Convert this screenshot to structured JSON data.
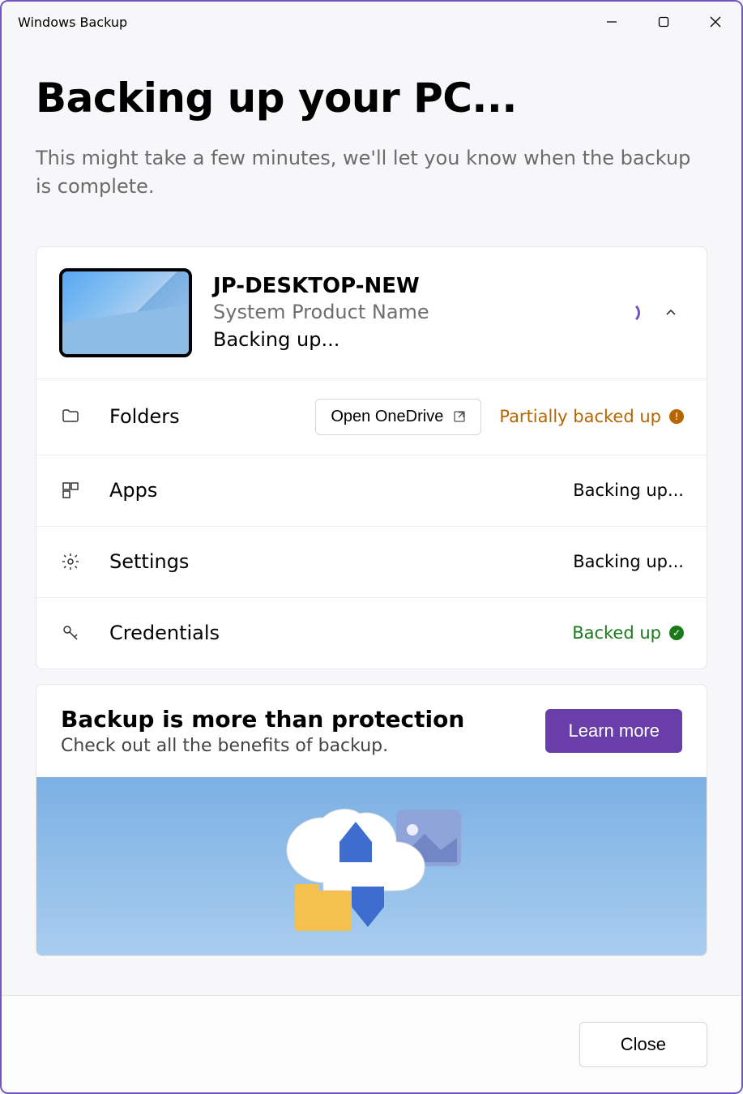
{
  "window": {
    "title": "Windows Backup"
  },
  "page": {
    "heading": "Backing up your PC...",
    "subheading": "This might take a few minutes, we'll let you know when the backup is complete."
  },
  "device": {
    "name": "JP-DESKTOP-NEW",
    "product": "System Product Name",
    "status": "Backing up..."
  },
  "rows": {
    "folders": {
      "label": "Folders",
      "action": "Open OneDrive",
      "status": "Partially backed up",
      "status_kind": "warn"
    },
    "apps": {
      "label": "Apps",
      "status": "Backing up...",
      "status_kind": "plain"
    },
    "settings": {
      "label": "Settings",
      "status": "Backing up...",
      "status_kind": "plain"
    },
    "credentials": {
      "label": "Credentials",
      "status": "Backed up",
      "status_kind": "ok"
    }
  },
  "promo": {
    "title": "Backup is more than protection",
    "subtitle": "Check out all the benefits of backup.",
    "cta": "Learn more"
  },
  "footer": {
    "close": "Close"
  }
}
